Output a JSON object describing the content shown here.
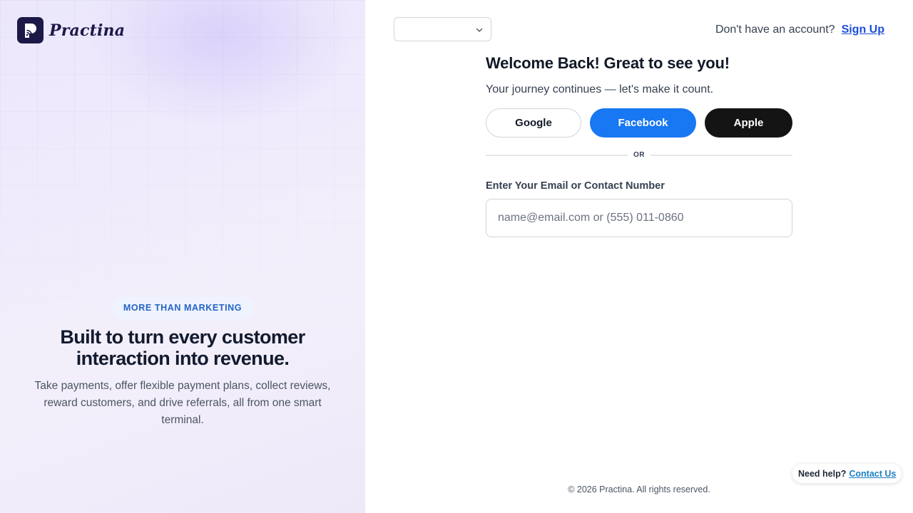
{
  "brand": {
    "name": "Practina"
  },
  "hero": {
    "badge": "MORE THAN MARKETING",
    "title": "Built to turn every customer interaction into revenue.",
    "description": "Take payments, offer flexible payment plans, collect reviews, reward customers, and drive referrals, all from one smart terminal."
  },
  "header": {
    "language_select": {
      "value": "",
      "icon": "chevron-down-icon"
    },
    "signup_prompt": "Don't have an account?",
    "signup_link": "Sign Up"
  },
  "login": {
    "title": "Welcome Back! Great to see you!",
    "subtitle": "Your journey continues — let's make it count.",
    "social_buttons": {
      "google": "Google",
      "facebook": "Facebook",
      "apple": "Apple"
    },
    "divider": "OR",
    "identifier_label": "Enter Your Email or Contact Number",
    "identifier_placeholder": "name@email.com or (555) 011-0860",
    "identifier_value": ""
  },
  "help": {
    "prompt": "Need help?",
    "link": "Contact Us"
  },
  "footer": {
    "copyright": "© 2026 Practina. All rights reserved."
  },
  "colors": {
    "brand": "#1c1848",
    "facebook": "#1877f2",
    "apple": "#141414",
    "link": "#1d4ed8",
    "badge_text": "#2563c9"
  }
}
